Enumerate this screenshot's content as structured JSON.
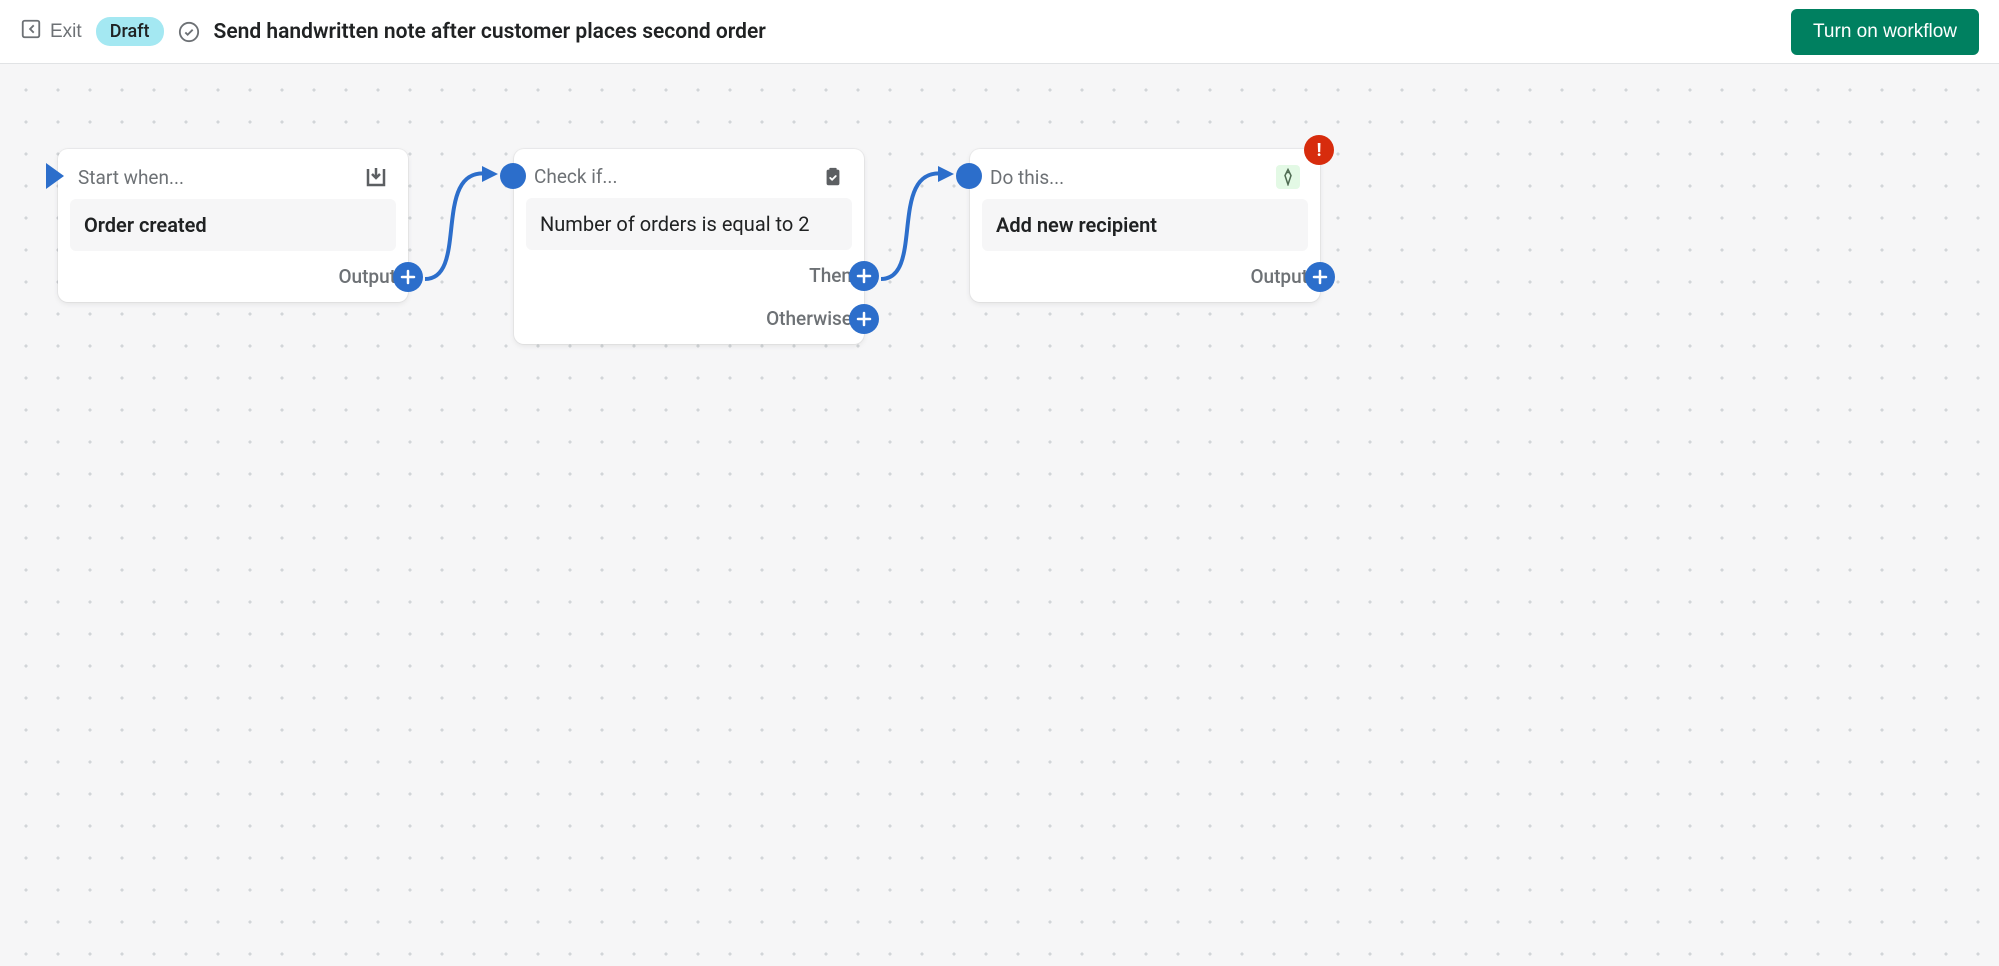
{
  "header": {
    "exit_label": "Exit",
    "status_badge": "Draft",
    "title": "Send handwritten note after customer places second order",
    "primary_action": "Turn on workflow"
  },
  "nodes": {
    "start": {
      "header_label": "Start when...",
      "body": "Order created",
      "outputs": [
        {
          "label": "Output"
        }
      ]
    },
    "condition": {
      "header_label": "Check if...",
      "body": "Number of orders is equal to 2",
      "outputs": [
        {
          "label": "Then"
        },
        {
          "label": "Otherwise"
        }
      ]
    },
    "action": {
      "header_label": "Do this...",
      "body": "Add new recipient",
      "outputs": [
        {
          "label": "Output"
        }
      ],
      "alert": "!"
    }
  }
}
